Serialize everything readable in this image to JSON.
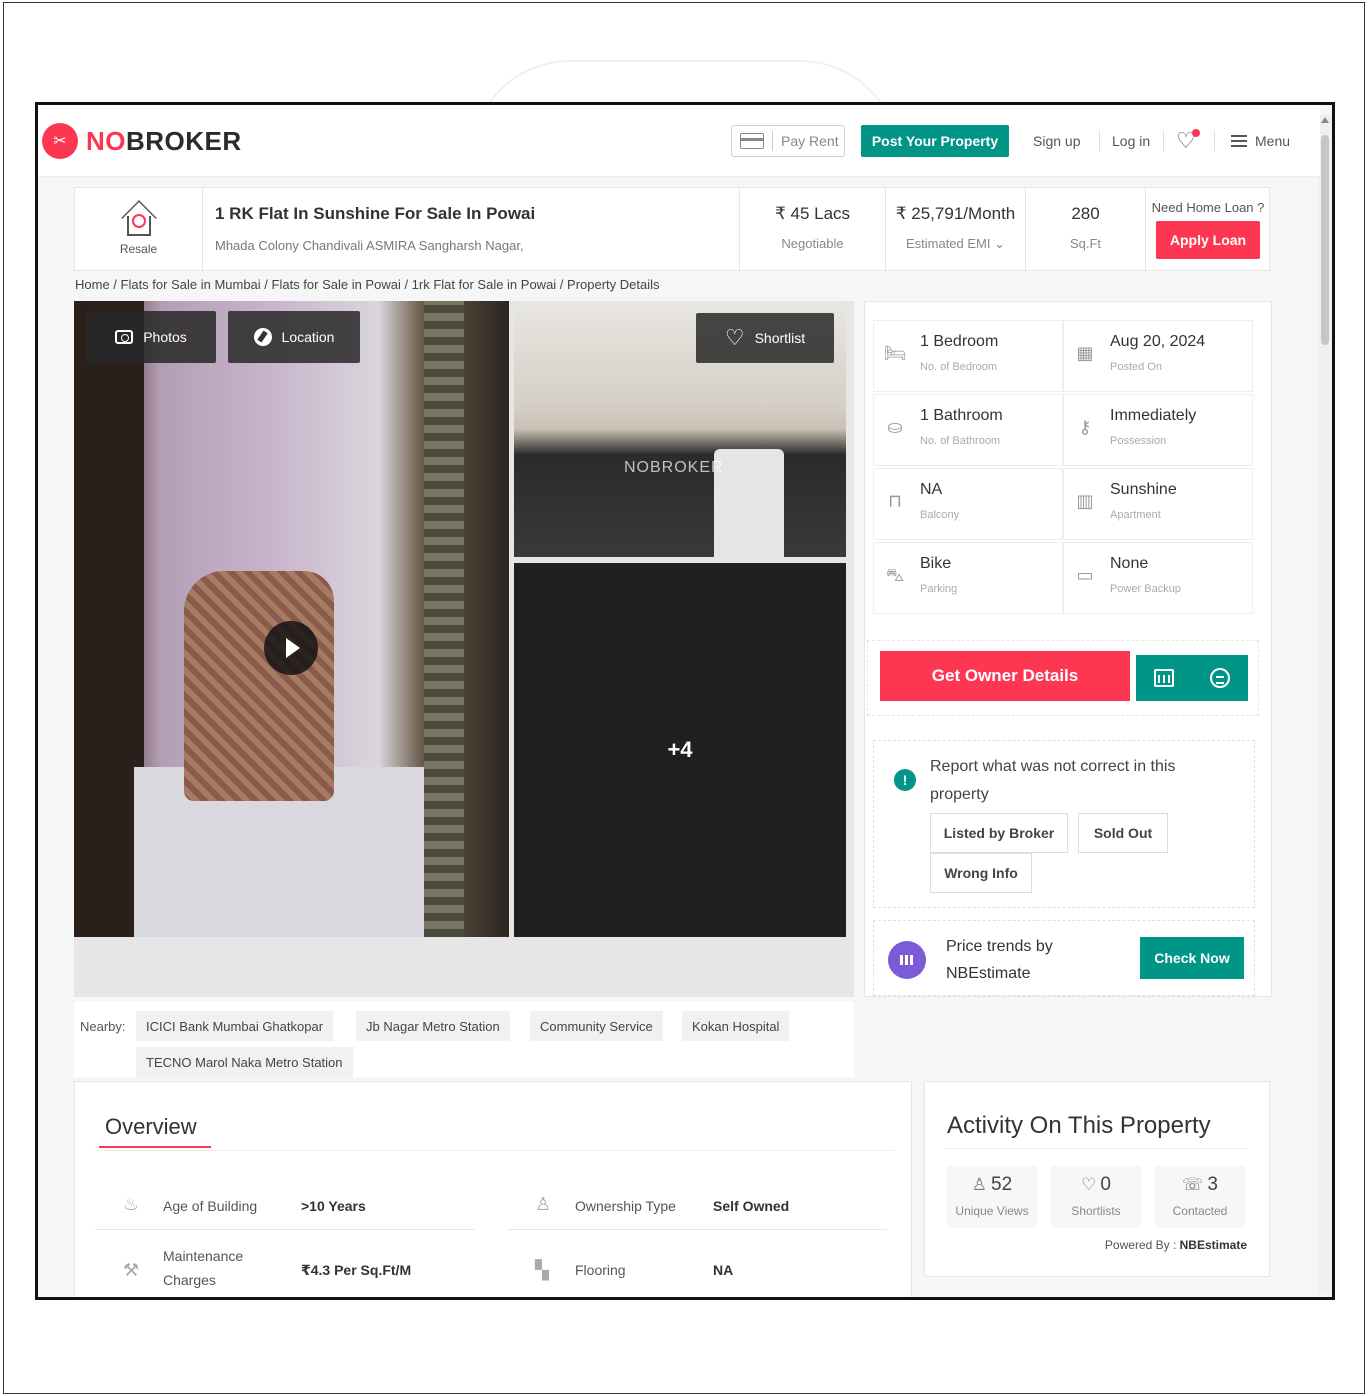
{
  "header": {
    "logo_no": "NO",
    "logo_rest": "BROKER",
    "pay_rent": "Pay Rent",
    "post_property": "Post Your Property",
    "sign_up": "Sign up",
    "log_in": "Log in",
    "menu": "Menu"
  },
  "listing": {
    "type_label": "Resale",
    "title": "1 RK Flat In Sunshine For Sale In Powai",
    "address": "Mhada Colony Chandivali ASMIRA Sangharsh Nagar,",
    "price": "₹ 45 Lacs",
    "price_sub": "Negotiable",
    "emi": "₹ 25,791/Month",
    "emi_sub": "Estimated EMI",
    "area": "280",
    "area_sub": "Sq.Ft",
    "loan_question": "Need Home Loan ?",
    "apply_loan": "Apply Loan"
  },
  "breadcrumb": "Home / Flats for Sale in Mumbai / Flats for Sale in Powai / 1rk Flat for Sale in Powai / Property Details",
  "gallery": {
    "photos": "Photos",
    "location": "Location",
    "shortlist": "Shortlist",
    "watermark": "NOBROKER",
    "more_count": "+4"
  },
  "specs": [
    {
      "value": "1 Bedroom",
      "sub": "No. of Bedroom",
      "icon": "bed-icon"
    },
    {
      "value": "Aug 20, 2024",
      "sub": "Posted On",
      "icon": "calendar-icon"
    },
    {
      "value": "1 Bathroom",
      "sub": "No. of Bathroom",
      "icon": "bathtub-icon"
    },
    {
      "value": "Immediately",
      "sub": "Possession",
      "icon": "key-icon"
    },
    {
      "value": "NA",
      "sub": "Balcony",
      "icon": "balcony-icon"
    },
    {
      "value": "Sunshine",
      "sub": "Apartment",
      "icon": "building-icon"
    },
    {
      "value": "Bike",
      "sub": "Parking",
      "icon": "car-icon"
    },
    {
      "value": "None",
      "sub": "Power Backup",
      "icon": "battery-icon"
    }
  ],
  "cta": {
    "owner_details": "Get Owner Details"
  },
  "report": {
    "text": "Report what was not correct in this property",
    "buttons": [
      "Listed by Broker",
      "Sold Out",
      "Wrong Info"
    ]
  },
  "trend": {
    "line1": "Price trends by",
    "line2": "NBEstimate",
    "check_now": "Check Now"
  },
  "nearby": {
    "label": "Nearby:",
    "places": [
      "ICICI Bank Mumbai Ghatkopar",
      "Jb Nagar Metro Station",
      "Community Service",
      "Kokan Hospital",
      "TECNO Marol Naka Metro Station"
    ]
  },
  "overview": {
    "title": "Overview",
    "rows": [
      {
        "key": "Age of Building",
        "value": ">10 Years",
        "icon": "cake-icon"
      },
      {
        "key": "Ownership Type",
        "value": "Self Owned",
        "icon": "owner-icon"
      },
      {
        "key": "Maintenance Charges",
        "value": "₹4.3 Per Sq.Ft/M",
        "icon": "tools-icon"
      },
      {
        "key": "Flooring",
        "value": "NA",
        "icon": "flooring-icon"
      }
    ]
  },
  "activity": {
    "title": "Activity On This Property",
    "stats": [
      {
        "value": "52",
        "label": "Unique Views",
        "icon": "user-icon"
      },
      {
        "value": "0",
        "label": "Shortlists",
        "icon": "heart-icon"
      },
      {
        "value": "3",
        "label": "Contacted",
        "icon": "phone-icon"
      }
    ],
    "powered_label": "Powered By :",
    "powered_value": "NBEstimate"
  },
  "colors": {
    "brand_red": "#fd3752",
    "brand_green": "#009587",
    "trend_purple": "#7c5cd6"
  }
}
